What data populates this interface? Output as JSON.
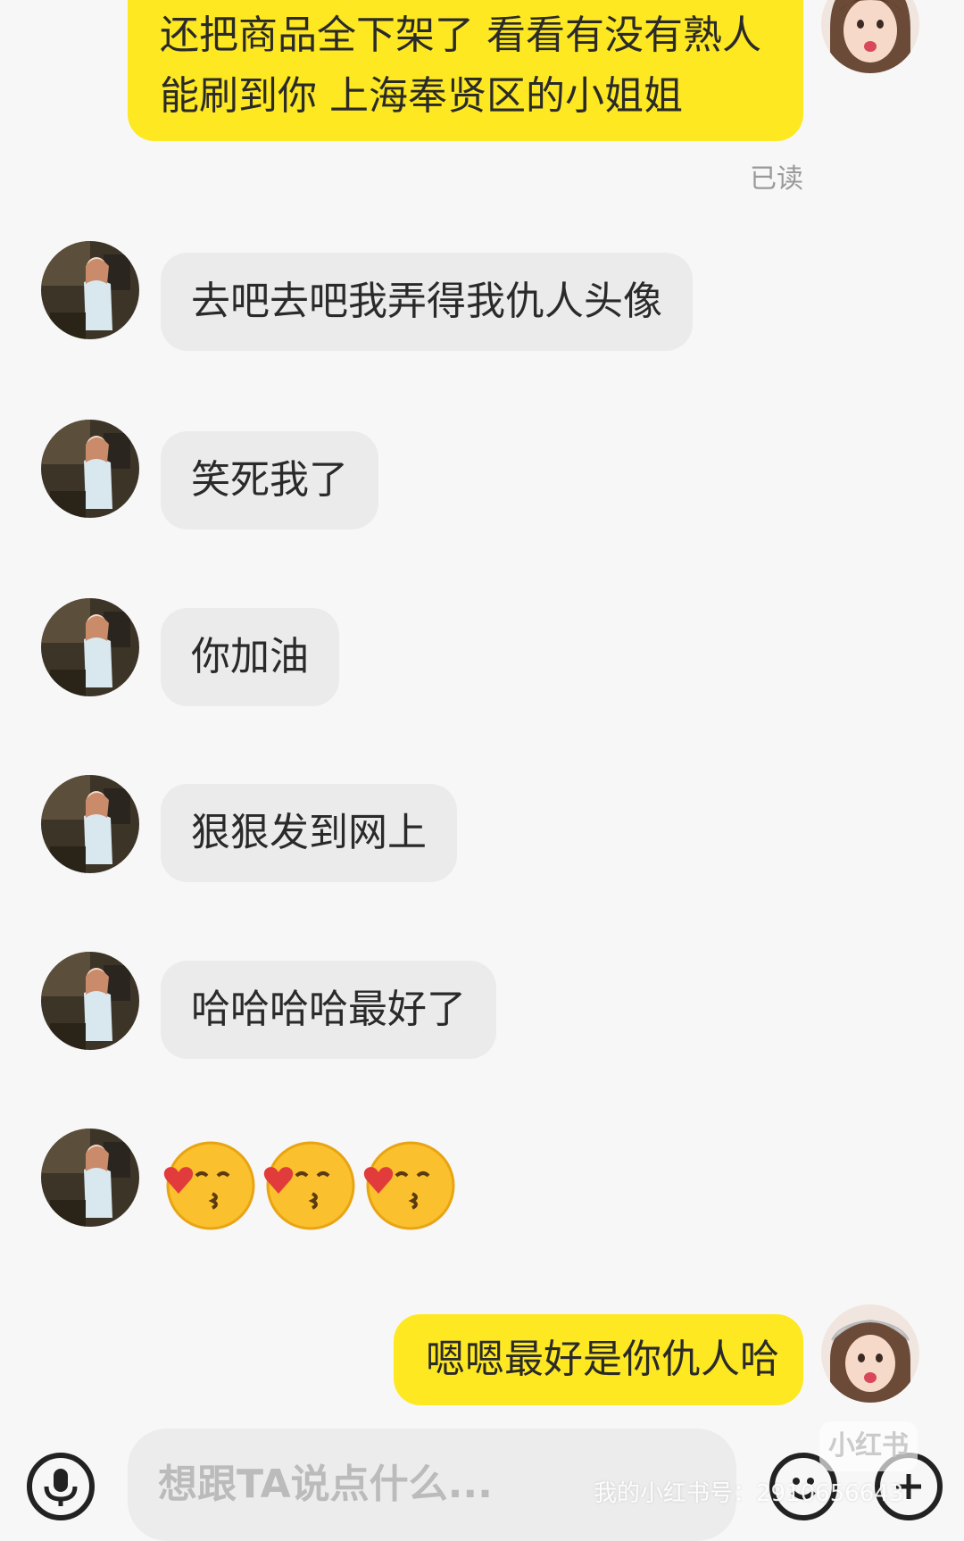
{
  "conversation": {
    "messages": [
      {
        "side": "out",
        "text_line1": "还把商品全下架了 看看有没有熟人",
        "text_line2": "能刷到你 上海奉贤区的小姐姐",
        "status": "已读"
      },
      {
        "side": "in",
        "text": "去吧去吧我弄得我仇人头像"
      },
      {
        "side": "in",
        "text": "笑死我了"
      },
      {
        "side": "in",
        "text": "你加油"
      },
      {
        "side": "in",
        "text": "狠狠发到网上"
      },
      {
        "side": "in",
        "text": "哈哈哈哈最好了"
      },
      {
        "side": "in",
        "emoji": "😚😚😚",
        "emoji_names": [
          "kissing-heart-emoji",
          "kissing-heart-emoji",
          "kissing-heart-emoji"
        ]
      },
      {
        "side": "out",
        "text": "嗯嗯最好是你仇人哈"
      }
    ]
  },
  "input_bar": {
    "placeholder": "想跟TA说点什么...",
    "icons": [
      "microphone-icon",
      "emoji-face-icon",
      "plus-icon"
    ]
  },
  "watermark": {
    "logo_text": "小红书",
    "account_text": "我的小红书号：2910656643"
  },
  "colors": {
    "outgoing_bubble": "#fde821",
    "incoming_bubble": "#ebebeb",
    "background": "#f7f7f7",
    "read_receipt": "#9a9a9a"
  }
}
